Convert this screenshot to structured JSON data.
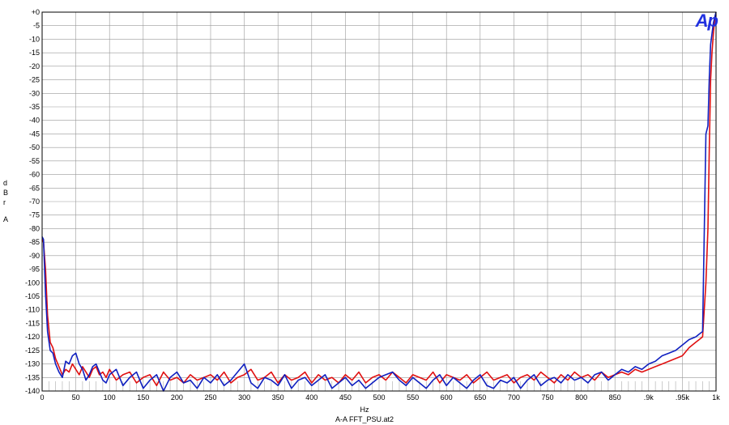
{
  "chart_data": {
    "type": "line",
    "title": "",
    "xlabel": "Hz",
    "ylabel": "dBr A",
    "ylabel_chars": [
      "d",
      "B",
      "r",
      "",
      "A"
    ],
    "filename": "A-A FFT_PSU.at2",
    "logo": "Ap",
    "xlim": [
      0,
      1000
    ],
    "ylim": [
      -140,
      0
    ],
    "grid": true,
    "xticks": [
      {
        "v": 0,
        "label": "0"
      },
      {
        "v": 50,
        "label": "50"
      },
      {
        "v": 100,
        "label": "100"
      },
      {
        "v": 150,
        "label": "150"
      },
      {
        "v": 200,
        "label": "200"
      },
      {
        "v": 250,
        "label": "250"
      },
      {
        "v": 300,
        "label": "300"
      },
      {
        "v": 350,
        "label": "350"
      },
      {
        "v": 400,
        "label": "400"
      },
      {
        "v": 450,
        "label": "450"
      },
      {
        "v": 500,
        "label": "500"
      },
      {
        "v": 550,
        "label": "550"
      },
      {
        "v": 600,
        "label": "600"
      },
      {
        "v": 650,
        "label": "650"
      },
      {
        "v": 700,
        "label": "700"
      },
      {
        "v": 750,
        "label": "750"
      },
      {
        "v": 800,
        "label": "800"
      },
      {
        "v": 850,
        "label": "850"
      },
      {
        "v": 900,
        "label": ".9k"
      },
      {
        "v": 950,
        "label": ".95k"
      },
      {
        "v": 1000,
        "label": "1k"
      }
    ],
    "yticks": [
      {
        "v": 0,
        "label": "+0"
      },
      {
        "v": -5,
        "label": "-5"
      },
      {
        "v": -10,
        "label": "-10"
      },
      {
        "v": -15,
        "label": "-15"
      },
      {
        "v": -20,
        "label": "-20"
      },
      {
        "v": -25,
        "label": "-25"
      },
      {
        "v": -30,
        "label": "-30"
      },
      {
        "v": -35,
        "label": "-35"
      },
      {
        "v": -40,
        "label": "-40"
      },
      {
        "v": -45,
        "label": "-45"
      },
      {
        "v": -50,
        "label": "-50"
      },
      {
        "v": -55,
        "label": "-55"
      },
      {
        "v": -60,
        "label": "-60"
      },
      {
        "v": -65,
        "label": "-65"
      },
      {
        "v": -70,
        "label": "-70"
      },
      {
        "v": -75,
        "label": "-75"
      },
      {
        "v": -80,
        "label": "-80"
      },
      {
        "v": -85,
        "label": "-85"
      },
      {
        "v": -90,
        "label": "-90"
      },
      {
        "v": -95,
        "label": "-95"
      },
      {
        "v": -100,
        "label": "-100"
      },
      {
        "v": -105,
        "label": "-105"
      },
      {
        "v": -110,
        "label": "-110"
      },
      {
        "v": -115,
        "label": "-115"
      },
      {
        "v": -120,
        "label": "-120"
      },
      {
        "v": -125,
        "label": "-125"
      },
      {
        "v": -130,
        "label": "-130"
      },
      {
        "v": -135,
        "label": "-135"
      },
      {
        "v": -140,
        "label": "-140"
      }
    ],
    "series": [
      {
        "color": "#e01010",
        "x": [
          0,
          2,
          5,
          8,
          12,
          16,
          20,
          25,
          30,
          35,
          40,
          45,
          50,
          55,
          60,
          65,
          70,
          75,
          80,
          85,
          90,
          95,
          100,
          110,
          120,
          130,
          140,
          150,
          160,
          170,
          180,
          190,
          200,
          210,
          220,
          230,
          240,
          250,
          260,
          270,
          280,
          290,
          300,
          310,
          320,
          330,
          340,
          350,
          360,
          370,
          380,
          390,
          400,
          410,
          420,
          430,
          440,
          450,
          460,
          470,
          480,
          490,
          500,
          510,
          520,
          530,
          540,
          550,
          560,
          570,
          580,
          590,
          600,
          610,
          620,
          630,
          640,
          650,
          660,
          670,
          680,
          690,
          700,
          710,
          720,
          730,
          740,
          750,
          760,
          770,
          780,
          790,
          800,
          810,
          820,
          830,
          840,
          850,
          860,
          870,
          880,
          890,
          900,
          910,
          920,
          930,
          940,
          950,
          960,
          970,
          975,
          980,
          985,
          988,
          990,
          992,
          994,
          996,
          998,
          1000
        ],
        "y": [
          -84,
          -85,
          -95,
          -112,
          -122,
          -124,
          -128,
          -131,
          -134,
          -132,
          -133,
          -130,
          -132,
          -134,
          -131,
          -133,
          -135,
          -132,
          -131,
          -134,
          -133,
          -135,
          -132,
          -136,
          -134,
          -133,
          -137,
          -135,
          -134,
          -138,
          -133,
          -136,
          -135,
          -137,
          -134,
          -136,
          -135,
          -134,
          -136,
          -133,
          -137,
          -135,
          -134,
          -132,
          -136,
          -135,
          -133,
          -137,
          -134,
          -136,
          -135,
          -133,
          -137,
          -134,
          -136,
          -135,
          -137,
          -134,
          -136,
          -133,
          -137,
          -135,
          -134,
          -136,
          -133,
          -135,
          -137,
          -134,
          -135,
          -136,
          -133,
          -137,
          -134,
          -135,
          -136,
          -134,
          -137,
          -135,
          -133,
          -136,
          -135,
          -134,
          -137,
          -135,
          -134,
          -136,
          -133,
          -135,
          -137,
          -134,
          -136,
          -133,
          -135,
          -134,
          -136,
          -133,
          -135,
          -134,
          -133,
          -134,
          -132,
          -133,
          -132,
          -131,
          -130,
          -129,
          -128,
          -127,
          -124,
          -122,
          -121,
          -120,
          -100,
          -80,
          -50,
          -25,
          -15,
          -8,
          -3,
          -1
        ]
      },
      {
        "color": "#1020c0",
        "x": [
          0,
          2,
          5,
          8,
          12,
          16,
          20,
          25,
          30,
          35,
          40,
          45,
          50,
          55,
          60,
          65,
          70,
          75,
          80,
          85,
          90,
          95,
          100,
          110,
          120,
          130,
          140,
          150,
          160,
          170,
          180,
          190,
          200,
          210,
          220,
          230,
          240,
          250,
          260,
          270,
          280,
          290,
          300,
          310,
          320,
          330,
          340,
          350,
          360,
          370,
          380,
          390,
          400,
          410,
          420,
          430,
          440,
          450,
          460,
          470,
          480,
          490,
          500,
          510,
          520,
          530,
          540,
          550,
          560,
          570,
          580,
          590,
          600,
          610,
          620,
          630,
          640,
          650,
          660,
          670,
          680,
          690,
          700,
          710,
          720,
          730,
          740,
          750,
          760,
          770,
          780,
          790,
          800,
          810,
          820,
          830,
          840,
          850,
          860,
          870,
          880,
          890,
          900,
          910,
          920,
          930,
          940,
          950,
          960,
          970,
          975,
          980,
          985,
          988,
          990,
          992,
          994,
          996,
          998,
          1000
        ],
        "y": [
          -83,
          -84,
          -104,
          -118,
          -125,
          -126,
          -130,
          -133,
          -135,
          -129,
          -130,
          -127,
          -126,
          -130,
          -132,
          -136,
          -134,
          -131,
          -130,
          -133,
          -136,
          -137,
          -134,
          -132,
          -138,
          -135,
          -133,
          -139,
          -136,
          -134,
          -140,
          -135,
          -133,
          -137,
          -136,
          -139,
          -135,
          -137,
          -134,
          -138,
          -136,
          -133,
          -130,
          -137,
          -139,
          -135,
          -136,
          -138,
          -134,
          -139,
          -136,
          -135,
          -138,
          -136,
          -134,
          -139,
          -137,
          -135,
          -138,
          -136,
          -139,
          -137,
          -135,
          -134,
          -133,
          -136,
          -138,
          -135,
          -137,
          -139,
          -136,
          -134,
          -138,
          -135,
          -137,
          -139,
          -136,
          -134,
          -138,
          -139,
          -136,
          -137,
          -135,
          -139,
          -136,
          -134,
          -138,
          -136,
          -135,
          -137,
          -134,
          -136,
          -135,
          -137,
          -134,
          -133,
          -136,
          -134,
          -132,
          -133,
          -131,
          -132,
          -130,
          -129,
          -127,
          -126,
          -125,
          -123,
          -121,
          -120,
          -119,
          -118,
          -45,
          -42,
          -24,
          -12,
          -8,
          -4,
          -2,
          0
        ]
      }
    ]
  }
}
